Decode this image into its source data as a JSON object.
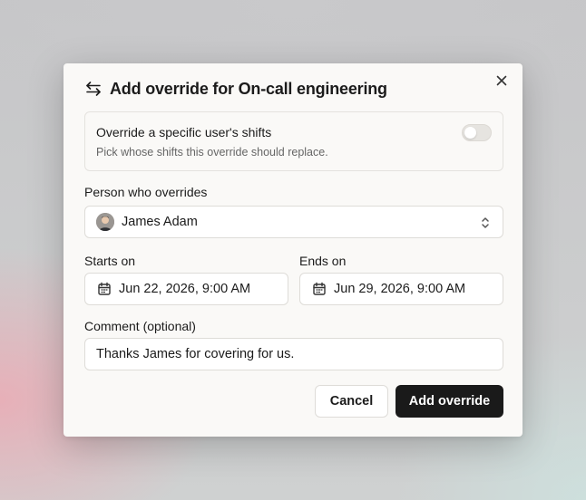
{
  "modal": {
    "title": "Add override for On-call engineering",
    "icons": {
      "title": "swap-arrows-icon",
      "close": "close-icon"
    }
  },
  "specific_user": {
    "title": "Override a specific user's shifts",
    "description": "Pick whose shifts this override should replace.",
    "enabled": false
  },
  "person": {
    "label": "Person who overrides",
    "value": "James Adam",
    "icons": {
      "avatar": "avatar",
      "dropdown": "chevrons-up-down-icon"
    }
  },
  "starts": {
    "label": "Starts on",
    "value": "Jun 22, 2026, 9:00 AM",
    "icon": "calendar-icon"
  },
  "ends": {
    "label": "Ends on",
    "value": "Jun 29, 2026, 9:00 AM",
    "icon": "calendar-icon"
  },
  "comment": {
    "label": "Comment (optional)",
    "value": "Thanks James for covering for us."
  },
  "actions": {
    "cancel": "Cancel",
    "submit": "Add override"
  },
  "colors": {
    "primary_button": "#1a1a1a",
    "modal_background": "#faf9f7"
  }
}
